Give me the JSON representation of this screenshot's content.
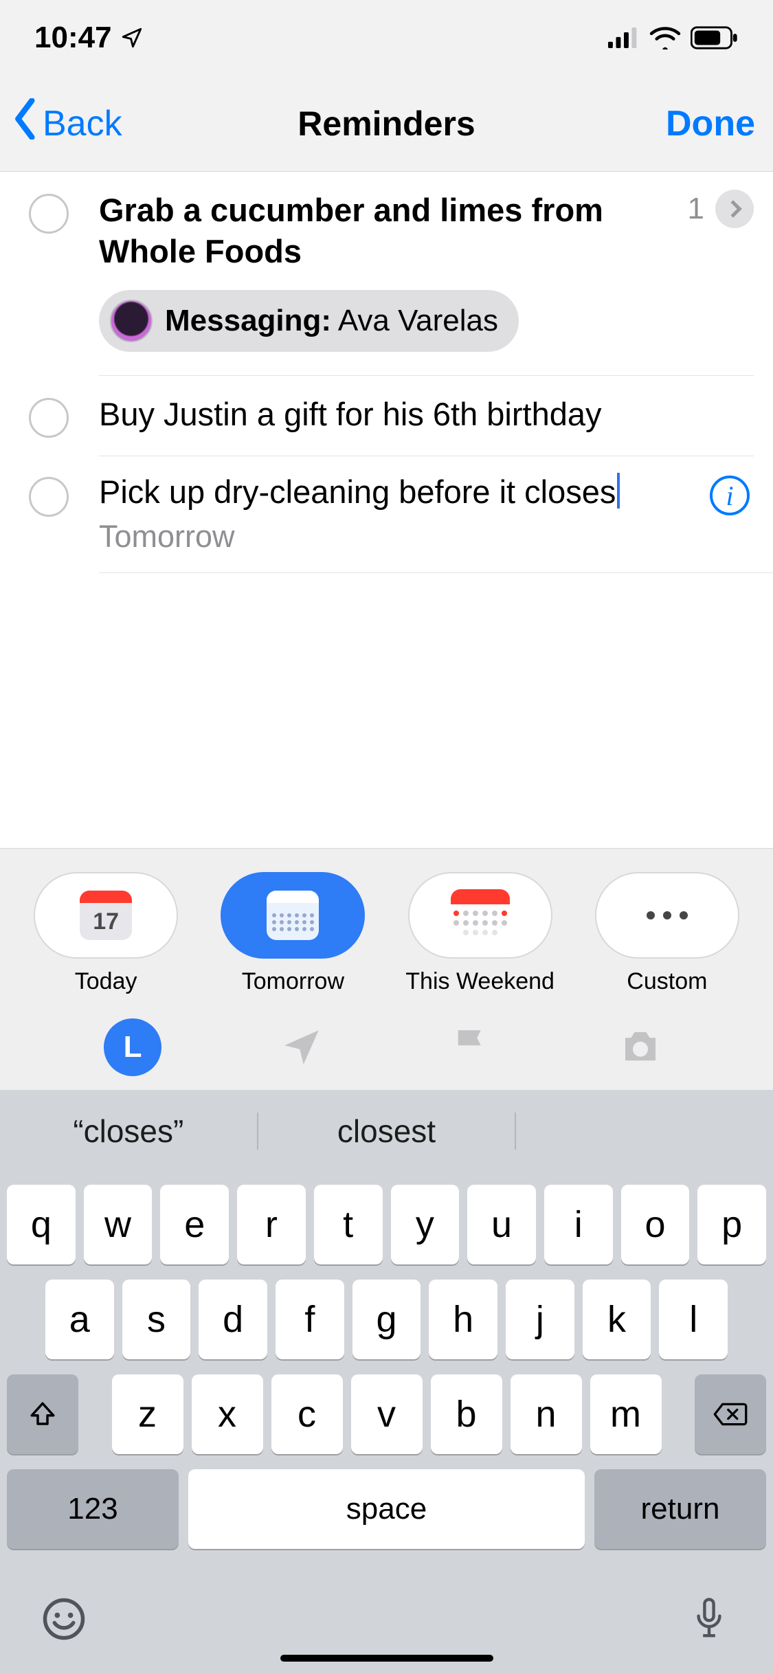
{
  "status": {
    "time": "10:47"
  },
  "nav": {
    "back": "Back",
    "title": "Reminders",
    "done": "Done"
  },
  "reminders": [
    {
      "title": "Grab a cucumber and limes from Whole Foods",
      "count": "1",
      "chip_label": "Messaging:",
      "chip_value": " Ava Varelas"
    },
    {
      "title": "Buy Justin a gift for his 6th birthday"
    },
    {
      "title": "Pick up dry-cleaning before it closes",
      "date": "Tomorrow"
    }
  ],
  "quickbar": {
    "today": {
      "label": "Today",
      "num": "17"
    },
    "tomorrow": {
      "label": "Tomorrow"
    },
    "weekend": {
      "label": "This Weekend"
    },
    "custom": {
      "label": "Custom"
    },
    "clock_letter": "L"
  },
  "keyboard": {
    "suggestions": [
      "“closes”",
      "closest",
      ""
    ],
    "row1": [
      "q",
      "w",
      "e",
      "r",
      "t",
      "y",
      "u",
      "i",
      "o",
      "p"
    ],
    "row2": [
      "a",
      "s",
      "d",
      "f",
      "g",
      "h",
      "j",
      "k",
      "l"
    ],
    "row3": [
      "z",
      "x",
      "c",
      "v",
      "b",
      "n",
      "m"
    ],
    "numbers": "123",
    "space": "space",
    "return": "return"
  }
}
